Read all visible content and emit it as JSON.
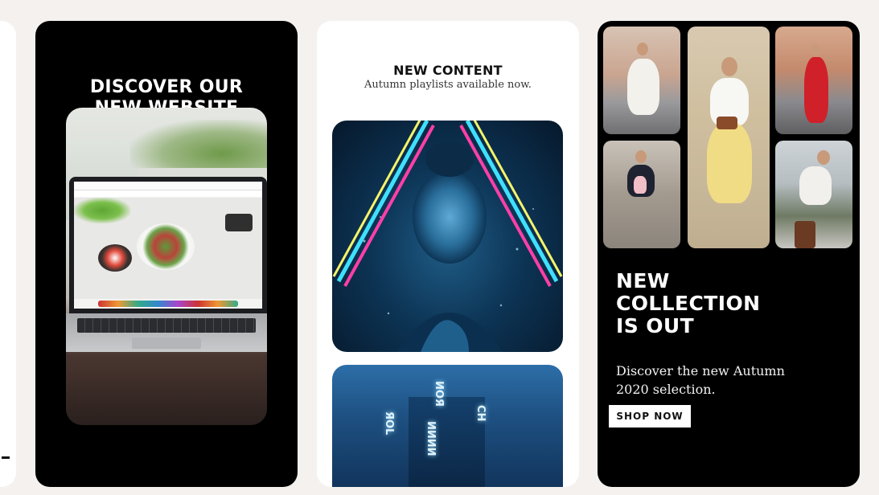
{
  "card_1": {
    "headline_line_1": "DISCOVER OUR",
    "headline_line_2": "NEW WEBSITE"
  },
  "card_2": {
    "title": "NEW CONTENT",
    "subtitle": "Autumn playlists available now.",
    "tunnel_neon_text": [
      "ЯOL",
      "ИИИИ",
      "ИОЯ",
      "СН"
    ]
  },
  "card_3": {
    "headline_lines": [
      "NEW",
      "COLLECTION",
      "IS OUT"
    ],
    "description": "Discover the new Autumn 2020 selection.",
    "button_label": "SHOP NOW"
  },
  "colors": {
    "page_background": "#f4f1ee",
    "dark_card": "#000000",
    "light_card": "#ffffff",
    "neon_pink": "#ff3fa8",
    "neon_cyan": "#3fe0ff",
    "neon_yellow": "#f4f46a",
    "dress_red": "#d0202a",
    "skirt_yellow": "#f1dc86"
  }
}
